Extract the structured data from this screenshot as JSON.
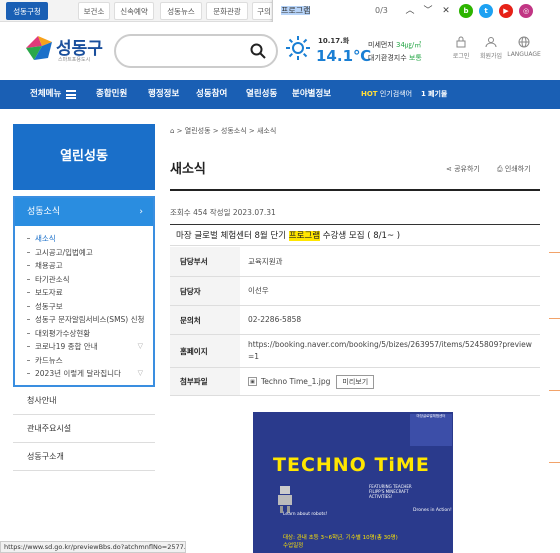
{
  "topbar": {
    "tabs": [
      "성동구청",
      "보건소",
      "신속예약",
      "성동뉴스",
      "문화관광",
      "구의"
    ],
    "active_tab": 0
  },
  "findbar": {
    "query": "프로그램",
    "count": "0/3"
  },
  "header": {
    "logo_text": "성동구",
    "logo_sub": "스마트포용도시",
    "search_placeholder": "",
    "weather_date": "10.17.화",
    "weather_temp": "14.1℃",
    "air_label": "미세먼지",
    "air_value": "34㎍/㎥",
    "env_label": "대기환경지수",
    "env_value": "보통",
    "util": [
      "로그인",
      "회원가입",
      "LANGUAGE"
    ]
  },
  "nav": {
    "all_menu": "전체메뉴",
    "items": [
      "종합민원",
      "행정정보",
      "성동참여",
      "열린성동",
      "분야별정보"
    ],
    "hot_label": "HOT",
    "hot_text": "인기검색어",
    "hot_rank": "1",
    "hot_keyword": "폐기물"
  },
  "sidebar": {
    "title": "열린성동",
    "section": "성동소식",
    "items": [
      "새소식",
      "고시공고/입법예고",
      "채용공고",
      "타기관소식",
      "보도자료",
      "성동구보",
      "성동구 문자알림서비스(SMS) 신청",
      "대외평가수상현황",
      "코로나19 종합 안내",
      "카드뉴스",
      "2023년 이렇게 달라집니다"
    ],
    "menus": [
      "청사안내",
      "관내주요시설",
      "성동구소개"
    ]
  },
  "content": {
    "breadcrumb": [
      "열린성동",
      "성동소식",
      "새소식"
    ],
    "page_title": "새소식",
    "share": "공유하기",
    "print": "인쇄하기",
    "meta": "조회수 454  작성일 2023.07.31",
    "post_title_pre": "마장 글로벌 체험센터 8월 단기 ",
    "post_title_hl": "프로그램",
    "post_title_post": " 수강생 모집 ( 8/1~ )",
    "rows": [
      {
        "label": "담당부서",
        "value": "교육지원과"
      },
      {
        "label": "담당자",
        "value": "이선우"
      },
      {
        "label": "문의처",
        "value": "02-2286-5858"
      },
      {
        "label": "홈페이지",
        "value": "https://booking.naver.com/booking/5/bizes/263957/items/5245809?preview=1"
      },
      {
        "label": "첨부파일",
        "value": "Techno Time_1.jpg"
      }
    ],
    "preview_btn": "미리보기"
  },
  "poster": {
    "title": "TECHNO TiME",
    "corner": "마장글로벌체험센터",
    "subtitle": "FEATURING TEACHER FILIPP'S MINECRAFT ACTIVITIES!",
    "label1": "Learn about robots!",
    "label2": "Drones in Action!",
    "bottom1": "대상: 관내 초등 3~6학년, 기수별 10명(총 30명)",
    "bottom2": "수업일정"
  },
  "statusbar": "https://www.sd.go.kr/previewBbs.do?atchmnflNo=2577..."
}
